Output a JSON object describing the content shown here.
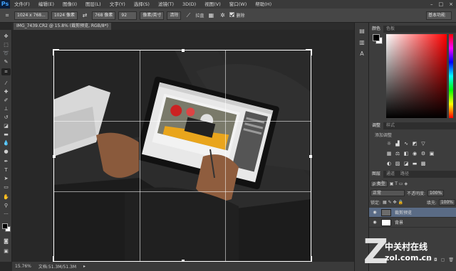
{
  "app": {
    "logo": "Ps",
    "menus": [
      "文件(F)",
      "编辑(E)",
      "图像(I)",
      "图层(L)",
      "文字(Y)",
      "选择(S)",
      "滤镜(T)",
      "3D(D)",
      "视图(V)",
      "窗口(W)",
      "帮助(H)"
    ],
    "window_controls": [
      "–",
      "□",
      "×"
    ]
  },
  "options_bar": {
    "preset": "1024 x 768...",
    "width": "1024 像素",
    "height": "768 像素",
    "resolution": "92",
    "resolution_unit": "像素/英寸",
    "clear_button": "清除",
    "straighten_label": "拉直",
    "delete_cropped_label": "删除",
    "workspace": "基本功能"
  },
  "document": {
    "tab_title": "IMG_7439.CR2 @ 15.8% (裁剪预览, RGB/8*)",
    "zoom": "15.76%",
    "doc_size": "文档:51.3M/51.3M"
  },
  "panels": {
    "color_tabs": [
      "颜色",
      "色板"
    ],
    "adjust_tabs": [
      "调整",
      "样式"
    ],
    "adjust_hint": "添加调整",
    "layers_tabs": [
      "图层",
      "通道",
      "路径"
    ],
    "kind_select": "类型",
    "blend_mode": "正常",
    "opacity_label": "不透明度:",
    "opacity_value": "100%",
    "lock_label": "锁定:",
    "fill_label": "填充:",
    "fill_value": "100%",
    "layers": [
      {
        "name": "裁剪预览",
        "selected": true
      },
      {
        "name": "背景",
        "selected": false
      }
    ],
    "foreground_color": "#000000",
    "background_color": "#ffffff"
  },
  "watermark": {
    "logo_letter": "Z",
    "cn": "中关村在线",
    "en": "zol.com.cn"
  }
}
